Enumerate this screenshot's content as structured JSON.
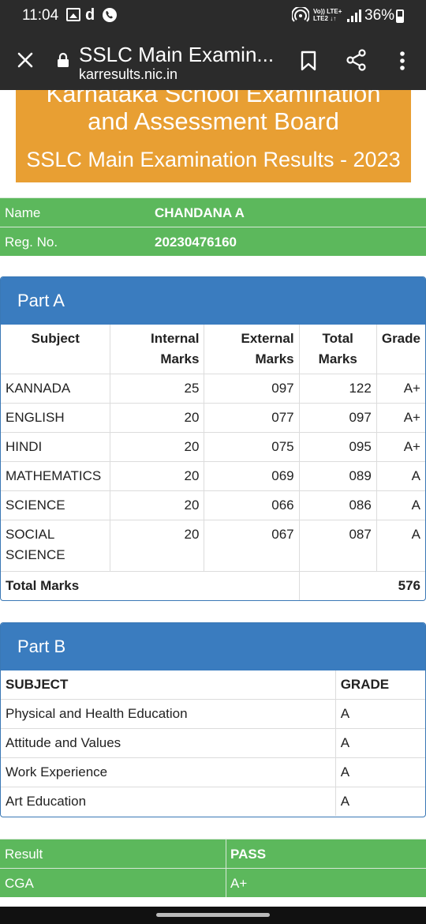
{
  "status_bar": {
    "time": "11:04",
    "volte_line1": "Vo)) LTE+",
    "volte_line2": "LTE2 ↓↑",
    "battery": "36%"
  },
  "browser": {
    "title": "SSLC Main Examin...",
    "url": "karresults.nic.in"
  },
  "banner": {
    "line1": "Karnataka School Examination",
    "line2": "and Assessment Board",
    "line3": "SSLC Main Examination Results - 2023"
  },
  "student": {
    "name_label": "Name",
    "name_value": "CHANDANA A",
    "reg_label": "Reg. No.",
    "reg_value": "20230476160"
  },
  "part_a": {
    "heading": "Part A",
    "headers": [
      "Subject",
      "Internal Marks",
      "External Marks",
      "Total Marks",
      "Grade"
    ],
    "rows": [
      {
        "subject": "KANNADA",
        "internal": "25",
        "external": "097",
        "total": "122",
        "grade": "A+"
      },
      {
        "subject": "ENGLISH",
        "internal": "20",
        "external": "077",
        "total": "097",
        "grade": "A+"
      },
      {
        "subject": "HINDI",
        "internal": "20",
        "external": "075",
        "total": "095",
        "grade": "A+"
      },
      {
        "subject": "MATHEMATICS",
        "internal": "20",
        "external": "069",
        "total": "089",
        "grade": "A"
      },
      {
        "subject": "SCIENCE",
        "internal": "20",
        "external": "066",
        "total": "086",
        "grade": "A"
      },
      {
        "subject": "SOCIAL SCIENCE",
        "internal": "20",
        "external": "067",
        "total": "087",
        "grade": "A"
      }
    ],
    "total_label": "Total Marks",
    "total_value": "576"
  },
  "part_b": {
    "heading": "Part B",
    "headers": [
      "SUBJECT",
      "GRADE"
    ],
    "rows": [
      {
        "subject": "Physical and Health Education",
        "grade": "A"
      },
      {
        "subject": "Attitude and Values",
        "grade": "A"
      },
      {
        "subject": "Work Experience",
        "grade": "A"
      },
      {
        "subject": "Art Education",
        "grade": "A"
      }
    ]
  },
  "result": {
    "result_label": "Result",
    "result_value": "PASS",
    "cga_label": "CGA",
    "cga_value": "A+"
  },
  "colors": {
    "status_bar": "#2b2b2b",
    "banner": "#e89f33",
    "green_row": "#5cb85c",
    "panel_heading": "#3a7cbf"
  }
}
